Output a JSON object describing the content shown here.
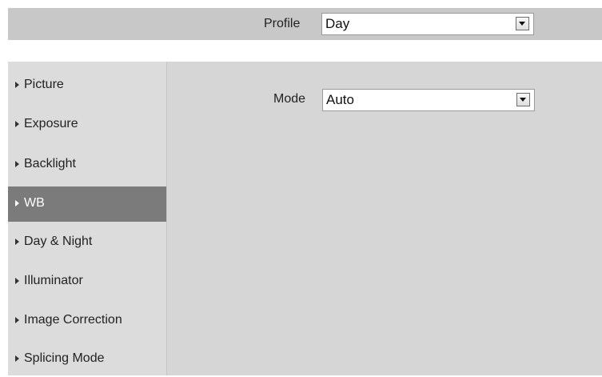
{
  "profile": {
    "label": "Profile",
    "value": "Day"
  },
  "mode": {
    "label": "Mode",
    "value": "Auto"
  },
  "sidebar": {
    "active": "WB",
    "items": [
      {
        "label": "Picture"
      },
      {
        "label": "Exposure"
      },
      {
        "label": "Backlight"
      },
      {
        "label": "WB"
      },
      {
        "label": "Day & Night"
      },
      {
        "label": "Illuminator"
      },
      {
        "label": "Image Correction"
      },
      {
        "label": "Splicing Mode"
      }
    ]
  },
  "colors": {
    "header_bar": "#c8c8c8",
    "sidebar_bg": "#dcdcdc",
    "content_bg": "#d6d6d6",
    "active_item_bg": "#7b7b7b",
    "active_item_text": "#ffffff"
  },
  "icons": {
    "nav_item": "triangle-right-icon",
    "dropdown": "chevron-down-icon"
  }
}
